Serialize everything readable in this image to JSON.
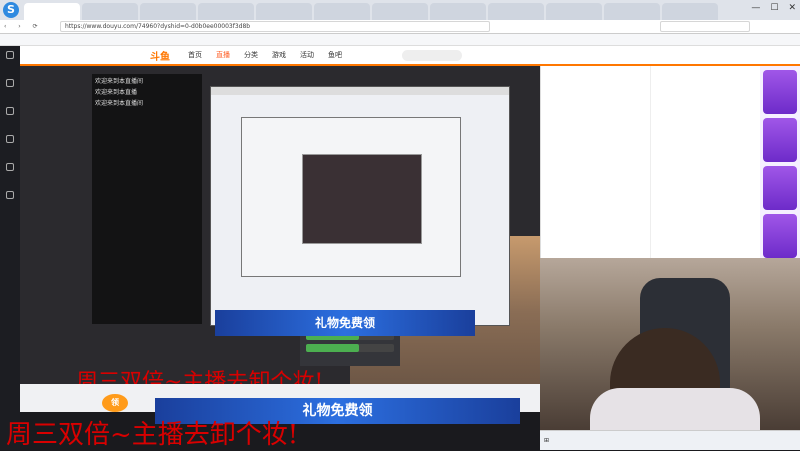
{
  "browser": {
    "tabs": [
      "",
      "",
      "",
      "",
      "",
      "",
      "",
      "",
      "",
      "",
      "",
      ""
    ],
    "url": "https://www.douyu.com/74960?dyshid=0-d0b0ee00003f3d8b",
    "search_placeholder": ""
  },
  "bookmarks": [],
  "site": {
    "logo": "斗鱼",
    "nav": [
      "首页",
      "直播",
      "分类",
      "游戏",
      "活动",
      "鱼吧"
    ],
    "active_nav": "直播"
  },
  "stream": {
    "chat_overlay": [
      {
        "user": "",
        "text": "欢迎来到本直播间"
      },
      {
        "user": "",
        "text": "欢迎来到本直播"
      },
      {
        "user": "",
        "text": "欢迎来到本直播间"
      }
    ],
    "overlay_text": "周三双倍~主播去卸个妆!",
    "banner_text": "礼物免费领",
    "gift_badge": "领"
  },
  "chat": {
    "messages": []
  },
  "gift_panel": {
    "messages": []
  },
  "rank": {
    "cards": [
      "",
      "",
      "",
      ""
    ]
  },
  "taskbar": {
    "time": "",
    "date": ""
  },
  "colors": {
    "accent": "#ff7700",
    "overlay_red": "#d90000",
    "banner_blue": "#2c6fe0"
  }
}
